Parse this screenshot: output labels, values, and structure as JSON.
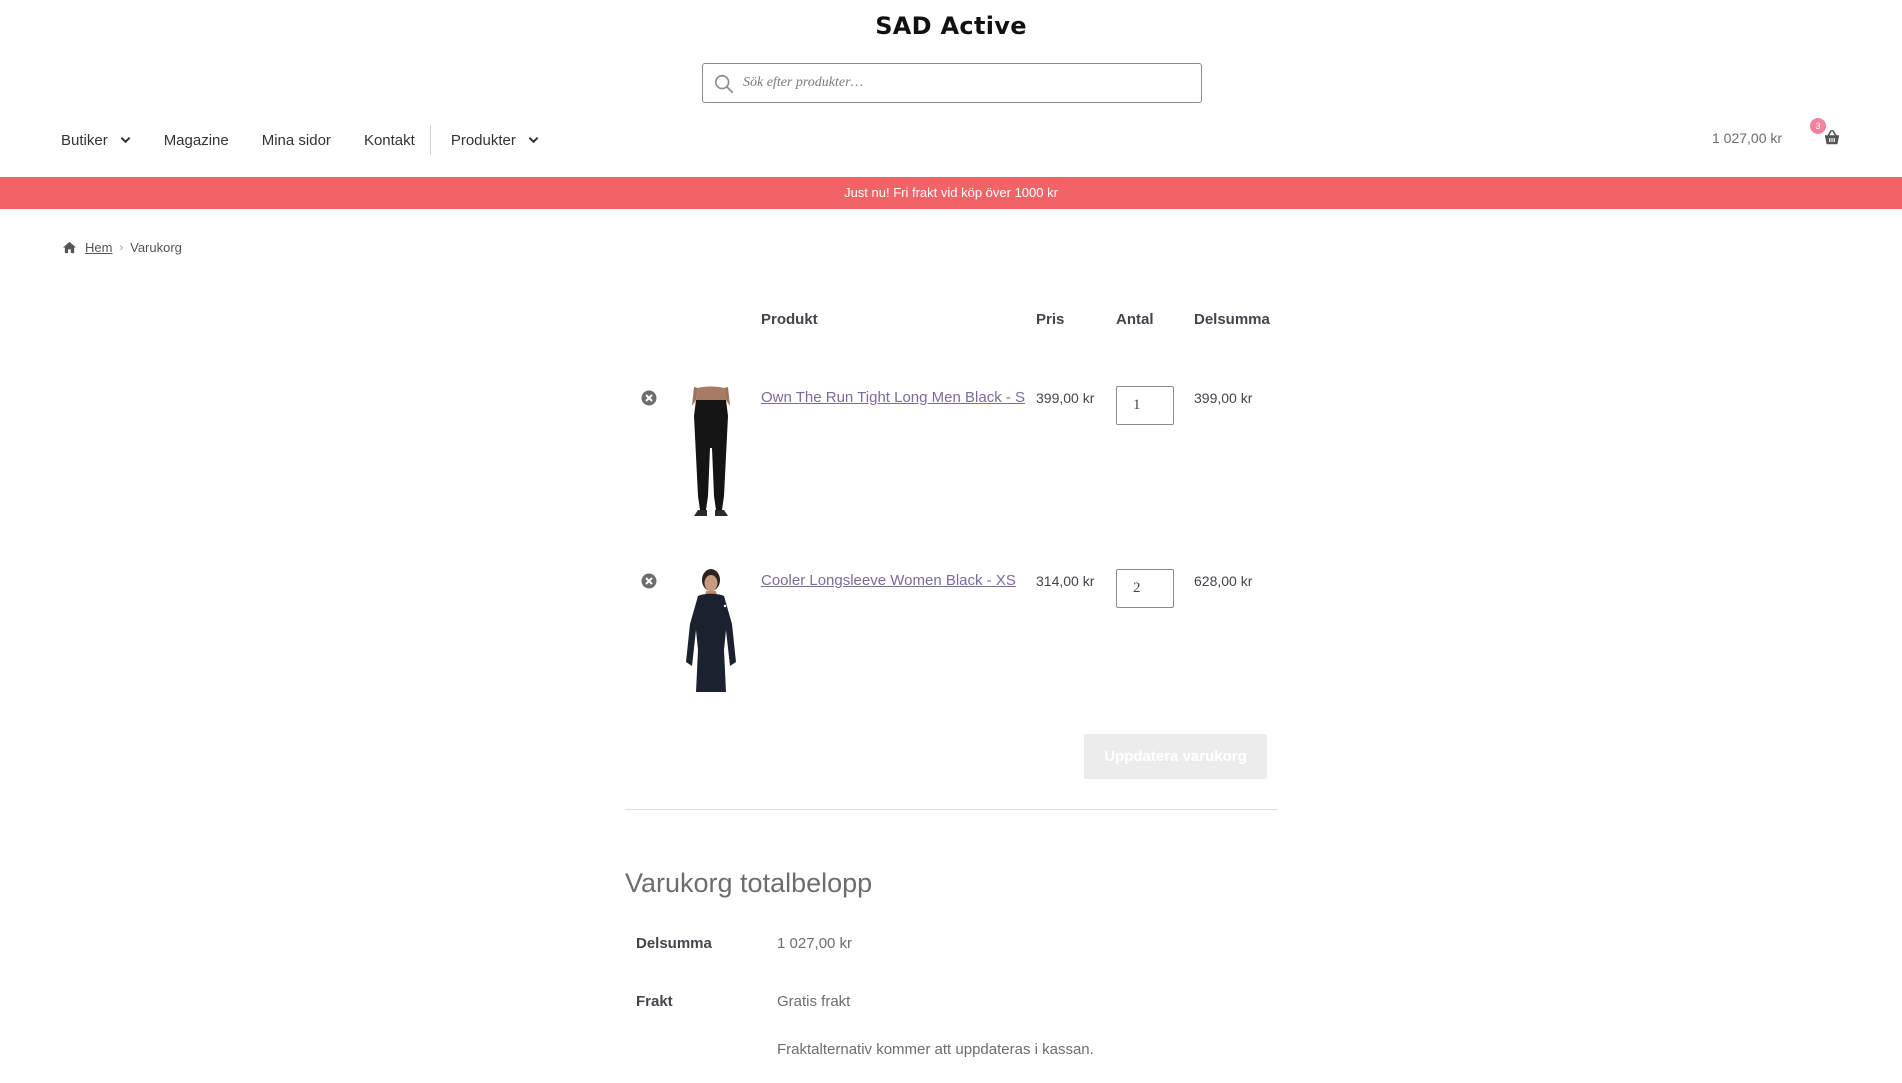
{
  "site": {
    "title": "SAD Active"
  },
  "search": {
    "placeholder": "Sök efter produkter…"
  },
  "nav": {
    "items": [
      {
        "label": "Butiker",
        "dropdown": true
      },
      {
        "label": "Magazine",
        "dropdown": false
      },
      {
        "label": "Mina sidor",
        "dropdown": false
      },
      {
        "label": "Kontakt",
        "dropdown": false
      },
      {
        "label": "Produkter",
        "dropdown": true
      }
    ]
  },
  "header_cart": {
    "total": "1 027,00 kr",
    "count": "3"
  },
  "promo": {
    "text": "Just nu! Fri frakt vid köp över 1000 kr"
  },
  "breadcrumb": {
    "home": "Hem",
    "current": "Varukorg"
  },
  "cart_table": {
    "headers": {
      "product": "Produkt",
      "price": "Pris",
      "quantity": "Antal",
      "subtotal": "Delsumma"
    },
    "rows": [
      {
        "name": "Own The Run Tight Long Men Black - S",
        "price": "399,00 kr",
        "quantity": "1",
        "subtotal": "399,00 kr"
      },
      {
        "name": "Cooler Longsleeve Women Black - XS",
        "price": "314,00 kr",
        "quantity": "2",
        "subtotal": "628,00 kr"
      }
    ],
    "update_button": "Uppdatera varukorg"
  },
  "totals": {
    "title": "Varukorg totalbelopp",
    "subtotal_label": "Delsumma",
    "subtotal_value": "1 027,00 kr",
    "shipping_label": "Frakt",
    "shipping_value": "Gratis frakt",
    "shipping_note": "Fraktalternativ kommer att uppdateras i kassan."
  },
  "colors": {
    "promo": "#f06468",
    "link": "#7b6c9a",
    "badge": "#f2819c"
  }
}
